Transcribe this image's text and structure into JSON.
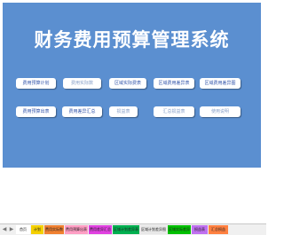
{
  "dashboard": {
    "title": "财务费用预算管理系统",
    "buttons_row1": [
      "费用预算计划",
      "费用实际数",
      "区域实际费表",
      "区域费用差异表",
      "区域费用差异图"
    ],
    "buttons_row2": [
      "费用预算出表",
      "费用差异汇总",
      "损益表",
      "汇总损益表",
      "使用说明"
    ]
  },
  "tabs": [
    {
      "label": "首页",
      "color": "#ffffff"
    },
    {
      "label": "计划",
      "color": "#f5d000"
    },
    {
      "label": "费用实际数",
      "color": "#f08030"
    },
    {
      "label": "费用预算出表",
      "color": "#ff9ec4"
    },
    {
      "label": "费用差异汇总",
      "color": "#e040e0"
    },
    {
      "label": "区域计划差异表",
      "color": "#00b050"
    },
    {
      "label": "区域计划差异图",
      "color": "#e8e8e8"
    },
    {
      "label": "区域实际差异",
      "color": "#00c000"
    },
    {
      "label": "损益表",
      "color": "#c070f0"
    },
    {
      "label": "汇总损益",
      "color": "#ff8040"
    }
  ],
  "nav": {
    "prev": "◀",
    "next": "▶"
  }
}
